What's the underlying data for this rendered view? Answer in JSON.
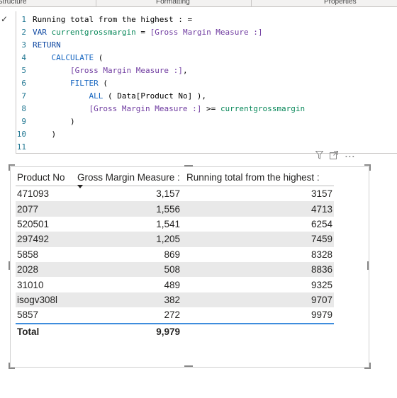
{
  "ribbon": {
    "tab_structure": "Structure",
    "tab_formatting": "Formatting",
    "tab_properties": "Properties"
  },
  "formula": {
    "line_numbers": [
      "1",
      "2",
      "3",
      "4",
      "5",
      "6",
      "7",
      "8",
      "9",
      "10",
      "11"
    ],
    "l1_text": "Running total from the highest : =",
    "l2_kw": "VAR",
    "l2_var": "currentgrossmargin",
    "l2_eq": " = ",
    "l2_meas": "[Gross Margin Measure :]",
    "l3_kw": "RETURN",
    "l4_fn": "CALCULATE",
    "l4_rest": " (",
    "l5_meas": "[Gross Margin Measure :]",
    "l5_rest": ",",
    "l6_fn": "FILTER",
    "l6_rest": " (",
    "l7_fn": "ALL",
    "l7_rest": " ( Data[Product No] ),",
    "l8_meas": "[Gross Margin Measure :]",
    "l8_op": " >= ",
    "l8_var": "currentgrossmargin",
    "l9_text": ")",
    "l10_text": ")"
  },
  "table": {
    "headers": {
      "product": "Product No",
      "gross": "Gross Margin Measure :",
      "running": "Running total from the highest :"
    },
    "rows": [
      {
        "product": "471093",
        "gross": "3,157",
        "running": "3157"
      },
      {
        "product": "2077",
        "gross": "1,556",
        "running": "4713"
      },
      {
        "product": "520501",
        "gross": "1,541",
        "running": "6254"
      },
      {
        "product": "297492",
        "gross": "1,205",
        "running": "7459"
      },
      {
        "product": "5858",
        "gross": "869",
        "running": "8328"
      },
      {
        "product": "2028",
        "gross": "508",
        "running": "8836"
      },
      {
        "product": "31010",
        "gross": "489",
        "running": "9325"
      },
      {
        "product": "isogv308l",
        "gross": "382",
        "running": "9707"
      },
      {
        "product": "5857",
        "gross": "272",
        "running": "9979"
      }
    ],
    "total": {
      "label": "Total",
      "gross": "9,979",
      "running": ""
    }
  },
  "icons": {
    "filter": "filter-icon",
    "focus": "focus-mode-icon",
    "more": "more-options-icon"
  }
}
